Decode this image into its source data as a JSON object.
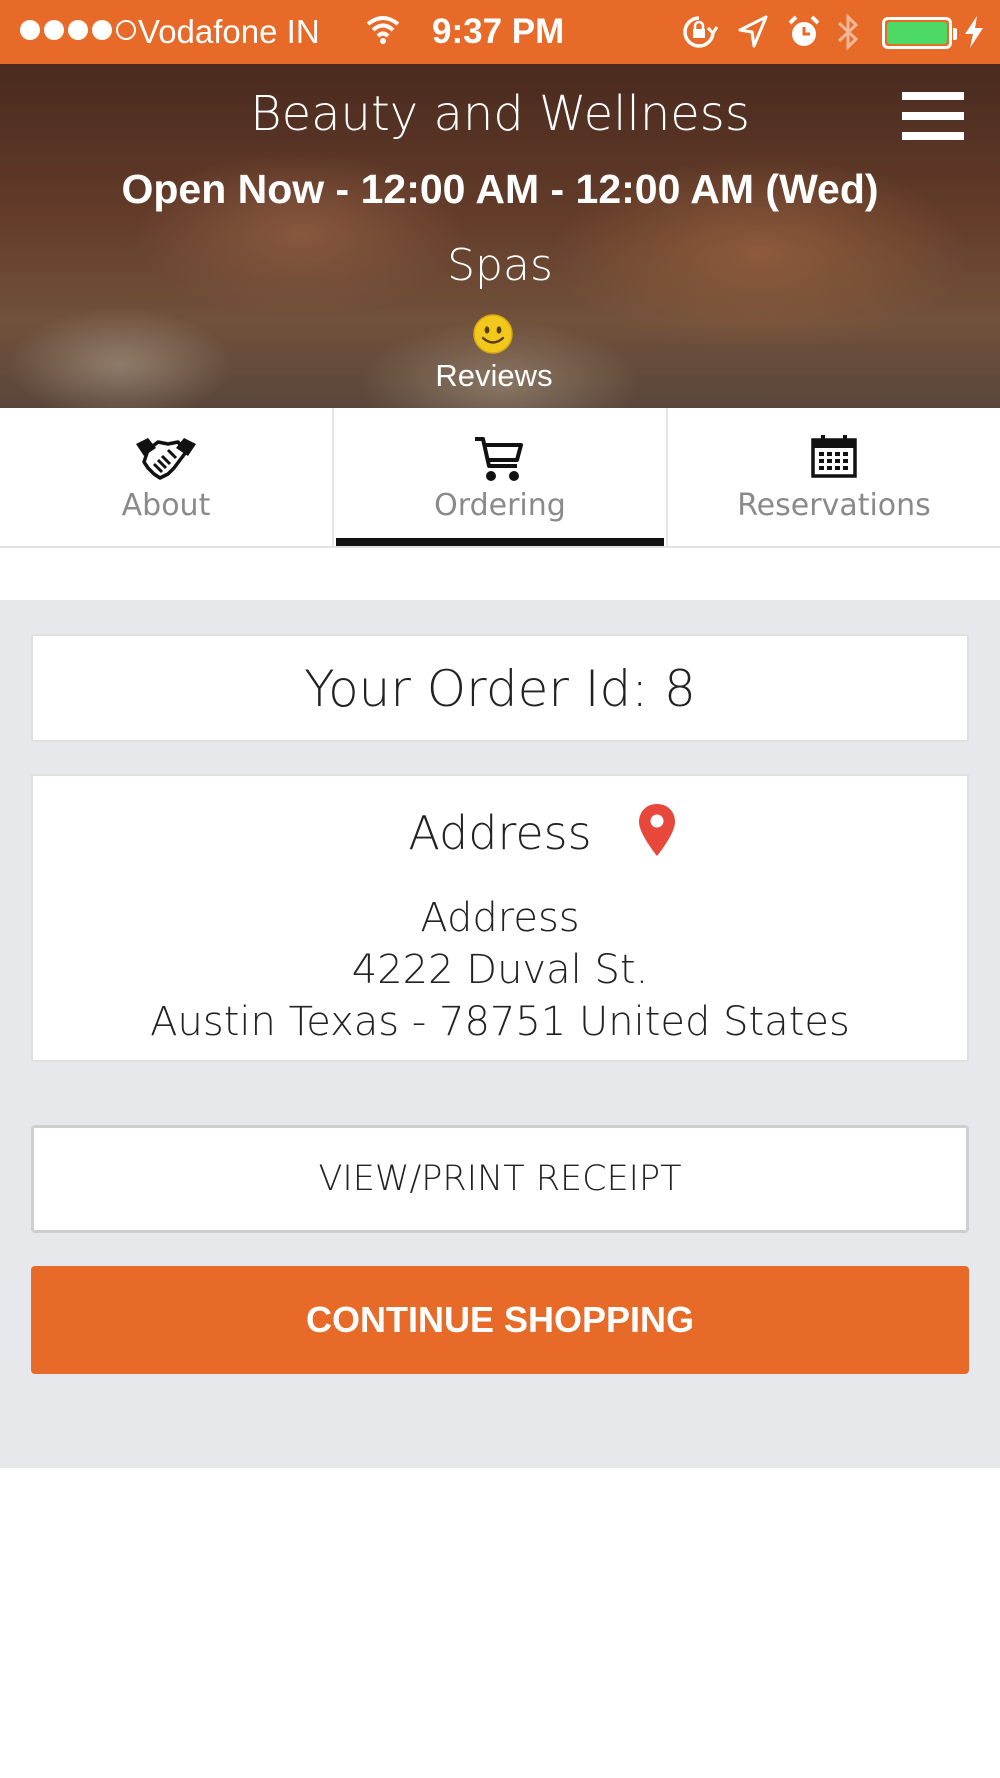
{
  "status_bar": {
    "carrier": "Vodafone IN",
    "time": "9:37 PM",
    "signal_bars_filled": 4,
    "signal_bars_total": 5,
    "battery_color": "#4cd964"
  },
  "header": {
    "title": "Beauty and Wellness",
    "hours": "Open Now - 12:00 AM - 12:00 AM (Wed)",
    "category": "Spas",
    "reviews_label": "Reviews",
    "menu_icon": "hamburger-menu-icon"
  },
  "tabs": [
    {
      "label": "About",
      "icon": "handshake-icon",
      "active": false
    },
    {
      "label": "Ordering",
      "icon": "cart-icon",
      "active": true
    },
    {
      "label": "Reservations",
      "icon": "calendar-icon",
      "active": false
    }
  ],
  "order": {
    "order_id_text": "Your Order Id: 8"
  },
  "address": {
    "title": "Address",
    "line1": "Address",
    "line2": "4222 Duval St.",
    "line3": "Austin Texas - 78751 United States",
    "pin_color": "#e8473b"
  },
  "buttons": {
    "receipt": "VIEW/PRINT RECEIPT",
    "continue": "CONTINUE SHOPPING"
  },
  "colors": {
    "accent": "#e86a28",
    "background": "#e7e8ec"
  }
}
